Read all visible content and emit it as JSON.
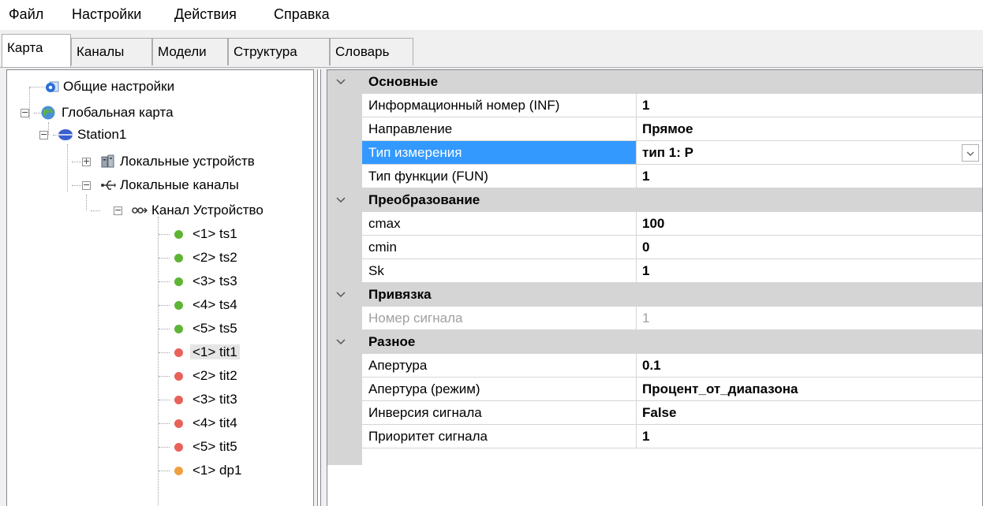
{
  "menu": [
    "Файл",
    "Настройки",
    "Действия",
    "Справка"
  ],
  "tabs": [
    "Карта",
    "Каналы",
    "Модели",
    "Структура",
    "Словарь"
  ],
  "tree": {
    "general_settings": "Общие настройки",
    "global_map": "Глобальная карта",
    "station": "Station1",
    "local_devices": "Локальные устройств",
    "local_channels": "Локальные каналы",
    "device_channel": "Канал Устройство",
    "signals": [
      {
        "label": "<1> ts1",
        "color": "#5db435"
      },
      {
        "label": "<2> ts2",
        "color": "#5db435"
      },
      {
        "label": "<3> ts3",
        "color": "#5db435"
      },
      {
        "label": "<4> ts4",
        "color": "#5db435"
      },
      {
        "label": "<5> ts5",
        "color": "#5db435"
      },
      {
        "label": "<1> tit1",
        "color": "#e8625a"
      },
      {
        "label": "<2> tit2",
        "color": "#e8625a"
      },
      {
        "label": "<3> tit3",
        "color": "#e8625a"
      },
      {
        "label": "<4> tit4",
        "color": "#e8625a"
      },
      {
        "label": "<5> tit5",
        "color": "#e8625a"
      },
      {
        "label": "<1> dp1",
        "color": "#f0a040"
      }
    ]
  },
  "props": {
    "cat1": "Основные",
    "inf_name": "Информационный номер (INF)",
    "inf_val": "1",
    "dir_name": "Направление",
    "dir_val": "Прямое",
    "meas_name": "Тип измерения",
    "meas_val": "тип 1: P",
    "fun_name": "Тип функции (FUN)",
    "fun_val": "1",
    "cat2": "Преобразование",
    "cmax_name": "cmax",
    "cmax_val": "100",
    "cmin_name": "cmin",
    "cmin_val": "0",
    "sk_name": "Sk",
    "sk_val": "1",
    "cat3": "Привязка",
    "sig_name": "Номер сигнала",
    "sig_val": "1",
    "cat4": "Разное",
    "ap_name": "Апертура",
    "ap_val": "0.1",
    "apm_name": "Апертура (режим)",
    "apm_val": "Процент_от_диапазона",
    "inv_name": "Инверсия сигнала",
    "inv_val": "False",
    "pri_name": "Приоритет сигнала",
    "pri_val": "1"
  },
  "colors": {
    "selection": "#3399ff",
    "category": "#d5d5d5"
  }
}
